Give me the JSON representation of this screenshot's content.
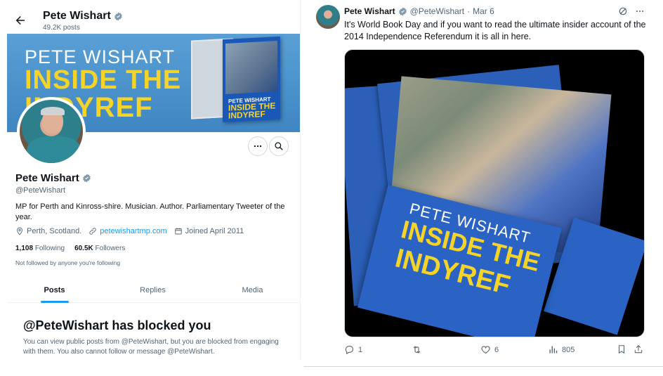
{
  "profile": {
    "top_name": "Pete Wishart",
    "posts_count": "49.2K posts",
    "banner": {
      "line1": "PETE WISHART",
      "line2": "INSIDE THE",
      "line3": "INDYREF",
      "book_small_title1": "PETE WISHART",
      "book_small_title2": "INSIDE THE INDYREF"
    },
    "name": "Pete Wishart",
    "handle": "@PeteWishart",
    "bio": "MP for Perth and Kinross-shire. Musician. Author. Parliamentary Tweeter of the year.",
    "location": "Perth, Scotland.",
    "website": "petewishartmp.com",
    "joined": "Joined April 2011",
    "following_count": "1,108",
    "following_label": "Following",
    "followers_count": "60.5K",
    "followers_label": "Followers",
    "not_followed": "Not followed by anyone you're following",
    "tabs": [
      {
        "label": "Posts",
        "active": true
      },
      {
        "label": "Replies",
        "active": false
      },
      {
        "label": "Media",
        "active": false
      }
    ],
    "blocked_title": "@PeteWishart has blocked you",
    "blocked_text": "You can view public posts from @PeteWishart, but you are blocked from engaging with them. You also cannot follow or message @PeteWishart."
  },
  "tweet": {
    "name": "Pete Wishart",
    "handle": "@PeteWishart",
    "separator": "·",
    "date": "Mar 6",
    "text": "It's World Book Day and if you want to read the ultimate insider account of the 2014 Independence Referendum it is all in here.",
    "media_titles": {
      "line1": "PETE WISHART",
      "line2": "INSIDE THE",
      "line3": "INDYREF"
    },
    "replies": "1",
    "retweets": "",
    "likes": "6",
    "views": "805"
  },
  "colors": {
    "accent": "#1d9bf0",
    "verified": "#829aab",
    "banner_blue": "#4a8fc8",
    "title_yellow": "#f5d328",
    "muted_text": "#536471"
  },
  "icons": [
    "back-arrow-icon",
    "verified-icon",
    "more-icon",
    "search-icon",
    "location-icon",
    "link-icon",
    "calendar-icon",
    "grok-icon",
    "reply-icon",
    "retweet-icon",
    "like-icon",
    "views-icon",
    "bookmark-icon",
    "share-icon"
  ]
}
